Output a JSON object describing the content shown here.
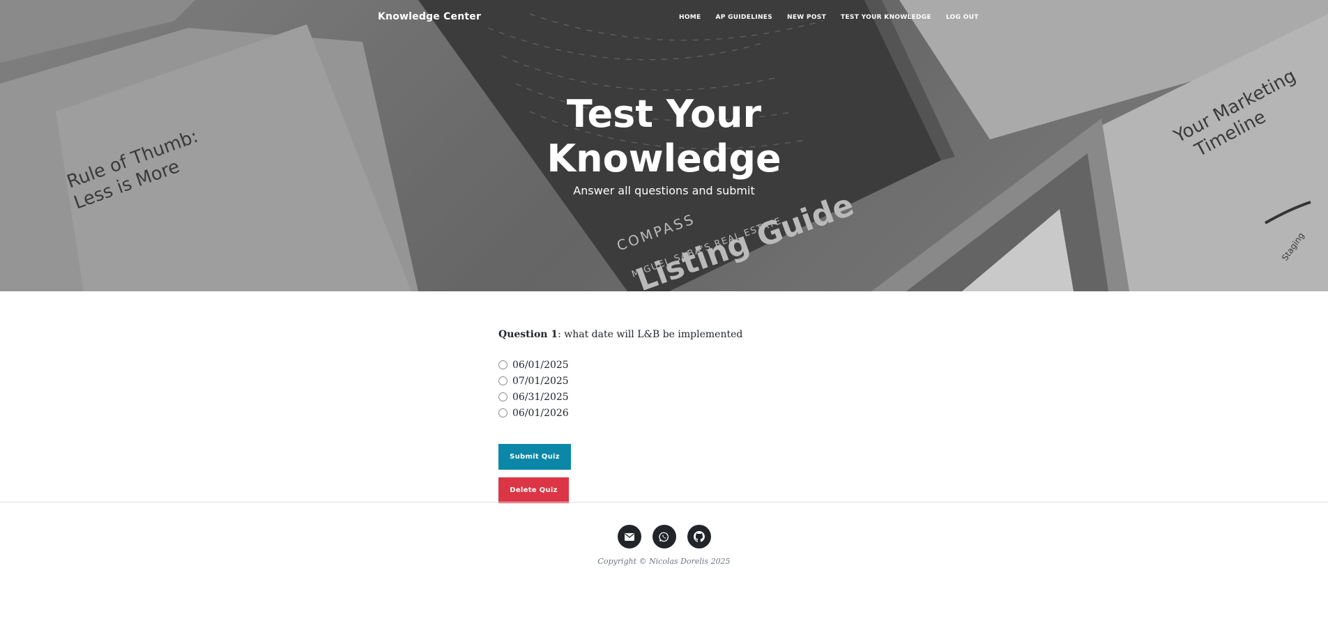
{
  "navbar": {
    "brand": "Knowledge Center",
    "links": [
      "Home",
      "AP Guidelines",
      "New Post",
      "Test Your Knowledge",
      "Log Out"
    ]
  },
  "hero": {
    "title": "Test Your Knowledge",
    "subtitle": "Answer all questions and submit",
    "background_words": {
      "compass": "COMPASS",
      "agent": "MIGUEL SABA'S REAL ESTATE",
      "guide": "Listing Guide",
      "left_heading_1": "Rule of Thumb:",
      "left_heading_2": "Less is More",
      "right_heading_1": "Your Marketing",
      "right_heading_2": "Timeline",
      "staging": "Staging"
    }
  },
  "quiz": {
    "question_label": "Question 1",
    "question_text": ": what date will L&B be implemented",
    "options": [
      "06/01/2025",
      "07/01/2025",
      "06/31/2025",
      "06/01/2026"
    ],
    "submit_label": "Submit Quiz",
    "delete_label": "Delete Quiz"
  },
  "footer": {
    "social_icons": [
      "envelope-icon",
      "whatsapp-icon",
      "github-icon"
    ],
    "copyright": "Copyright © Nicolas Dorelis 2025"
  },
  "colors": {
    "submit_button": "#0b87a8",
    "delete_button": "#dc3545",
    "social_circle": "#212529"
  }
}
